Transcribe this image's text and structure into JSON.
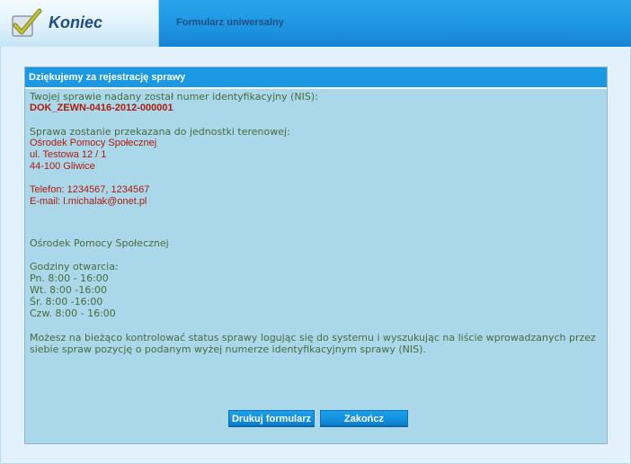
{
  "header": {
    "title": "Koniec",
    "subtitle": "Formularz uniwersalny"
  },
  "panel": {
    "title": "Dziękujemy za rejestrację sprawy",
    "nis_intro": "Twojej sprawie nadany został numer identyfikacyjny (NIS):",
    "nis_number": "DOK_ZEWN-0416-2012-000001",
    "forward_intro": "Sprawa zostanie przekazana do jednostki terenowej:",
    "unit": {
      "name": "Ośrodek Pomocy Społecznej",
      "street": "ul. Testowa 12 / 1",
      "city": "44-100 Gliwice",
      "phone": "Telefon: 1234567, 1234567",
      "email": "E-mail: l.michalak@onet.pl"
    },
    "office_name": "Ośrodek Pomocy Społecznej",
    "hours_title": "Godziny otwarcia:",
    "hours": [
      "Pn. 8:00 - 16:00",
      "Wt. 8:00 -16:00",
      "Śr. 8:00 -16:00",
      "Czw. 8:00 - 16:00"
    ],
    "status_info": "Możesz na bieżąco kontrolować status sprawy logując się do systemu i wyszukując na liście wprowadzanych przez siebie spraw pozycję o podanym wyżej numerze identyfikacyjnym sprawy (NIS)."
  },
  "buttons": {
    "print_label": "Drukuj formularz",
    "finish_label": "Zakończ"
  },
  "colors": {
    "header_blue": "#1f95e2",
    "panel_bg": "#aad8ea",
    "highlight_red": "#b01a0a",
    "body_text": "#4a6a3c"
  }
}
